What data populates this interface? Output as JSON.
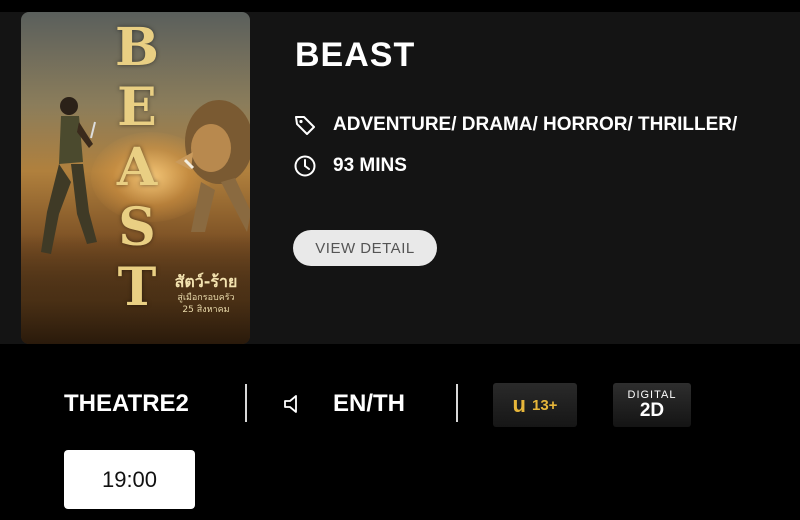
{
  "movie": {
    "title": "BEAST",
    "genres": "ADVENTURE/ DRAMA/ HORROR/ THRILLER/",
    "duration": "93 MINS",
    "view_detail_label": "VIEW DETAIL",
    "poster": {
      "title_letters": [
        "B",
        "E",
        "A",
        "S",
        "T"
      ],
      "thai_title": "สัตว์-ร้าย",
      "thai_tagline": "สู่เมือกรอบครัว",
      "release": "25 สิงหาคม"
    }
  },
  "show": {
    "theatre": "THEATRE2",
    "language": "EN/TH",
    "rating_letter": "u",
    "rating_age": "13+",
    "format_top": "DIGITAL",
    "format_bottom": "2D",
    "showtimes": [
      "19:00"
    ]
  },
  "icons": {
    "genre": "tag-icon",
    "duration": "clock-icon",
    "audio": "speaker-icon"
  },
  "colors": {
    "background": "#000000",
    "card": "#141414",
    "rating_gold": "#e7b63a",
    "button_bg": "#e9e9e9"
  }
}
